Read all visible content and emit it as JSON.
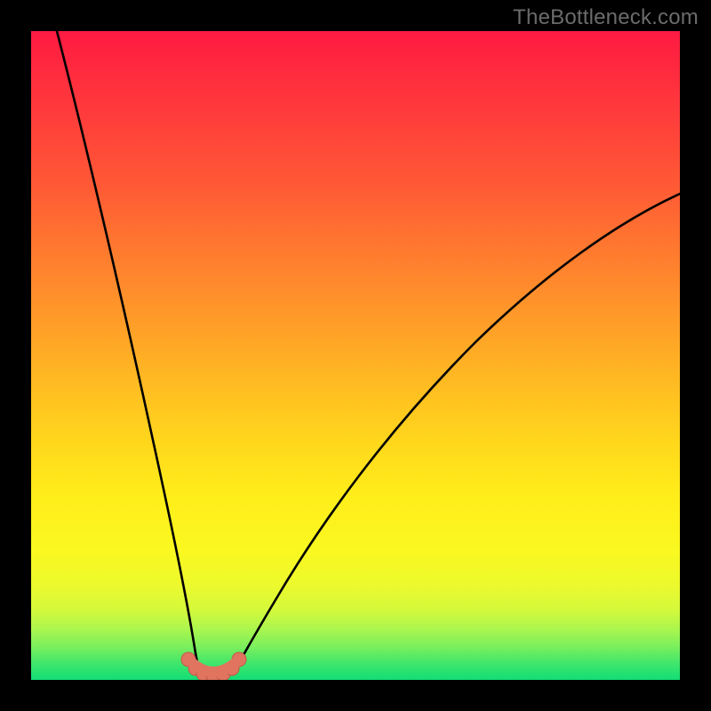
{
  "watermark": {
    "text": "TheBottleneck.com"
  },
  "chart_data": {
    "type": "line",
    "title": "",
    "xlabel": "",
    "ylabel": "",
    "xlim": [
      0,
      100
    ],
    "ylim": [
      0,
      100
    ],
    "grid": false,
    "legend": false,
    "series": [
      {
        "name": "left-curve",
        "x": [
          4,
          6,
          8,
          10,
          12,
          14,
          16,
          18,
          20,
          22,
          23.5,
          25,
          26
        ],
        "values": [
          100,
          90,
          80,
          70,
          60,
          50,
          41,
          32,
          22,
          12,
          6,
          2,
          0.8
        ]
      },
      {
        "name": "right-curve",
        "x": [
          31,
          33,
          36,
          40,
          45,
          50,
          56,
          63,
          71,
          80,
          89,
          97,
          100
        ],
        "values": [
          0.8,
          4,
          10,
          18,
          27,
          35,
          43,
          51,
          58,
          64,
          70,
          74,
          75
        ]
      },
      {
        "name": "valley-markers",
        "style": "markers",
        "marker_color": "#e0745f",
        "marker_size": 10,
        "x": [
          24.2,
          25.3,
          26.6,
          28.1,
          29.6,
          30.9,
          32.0
        ],
        "values": [
          3.2,
          1.7,
          0.9,
          0.7,
          0.9,
          1.7,
          3.2
        ]
      }
    ],
    "background_gradient_stops": [
      {
        "pct": 0,
        "color": "#ff1a42"
      },
      {
        "pct": 24,
        "color": "#ff5a35"
      },
      {
        "pct": 54,
        "color": "#ffba22"
      },
      {
        "pct": 80,
        "color": "#faf820"
      },
      {
        "pct": 95,
        "color": "#78ef5e"
      },
      {
        "pct": 100,
        "color": "#12dd76"
      }
    ],
    "annotations": []
  }
}
